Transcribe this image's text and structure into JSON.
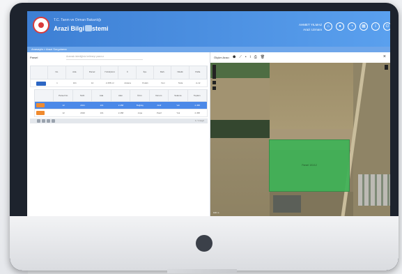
{
  "app": {
    "small_title": "T.C. Tarım ve Orman Bakanlığı",
    "title": "Arazi Bilgi Sistemi",
    "user_name": "AHMET YILMAZ",
    "user_role": "Arazi Uzmanı"
  },
  "toolbar_icons": [
    "home-icon",
    "user-icon",
    "bell-icon",
    "grid-icon",
    "info-icon",
    "logout-icon"
  ],
  "breadcrumb": "Anasayfa > Arazi Sorgulama",
  "left": {
    "search_label": "Parsel",
    "search_placeholder": "Aramak istediğiniz kelimeyi yazınız",
    "table1_headers": [
      "",
      "No",
      "Ada",
      "Parsel",
      "Yüzölçümü",
      "İl",
      "İlçe",
      "Mah.",
      "Nitelik",
      "Pafta"
    ],
    "table1_row": [
      "",
      "1",
      "101",
      "12",
      "2.458 m²",
      "Ankara",
      "Polatlı",
      "Yeni",
      "Tarla",
      "A-12"
    ],
    "table2_headers": [
      "",
      "Parsel No",
      "Tarih",
      "Ada",
      "Alan",
      "Ürün",
      "Durum",
      "Sulama",
      "Toplam"
    ],
    "table2_rows": [
      [
        "",
        "12",
        "2021",
        "101",
        "2.458",
        "Buğday",
        "Aktif",
        "Var",
        "2.458"
      ],
      [
        "",
        "12",
        "2020",
        "101",
        "2.458",
        "Arpa",
        "Pasif",
        "Yok",
        "2.458"
      ]
    ],
    "pager_info": "1 / 1 kayıt"
  },
  "right": {
    "map_label": "Ölçüm Aracı",
    "map_icons": [
      "polygon-icon",
      "line-icon",
      "point-icon",
      "info-icon",
      "print-icon",
      "delete-icon"
    ],
    "close": "×",
    "field_label": "Parsel 101/12",
    "scale": "100 m"
  },
  "colors": {
    "topbar": "#3d7fd4",
    "accent_blue": "#4b89e8",
    "accent_orange": "#f08a2e",
    "field_green": "#3fb357"
  }
}
